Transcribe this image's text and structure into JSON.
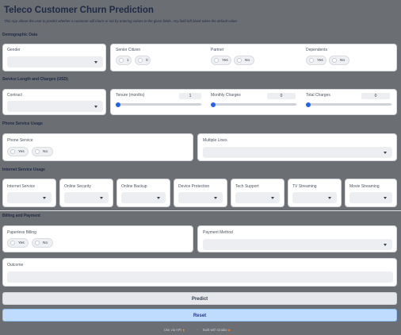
{
  "header": {
    "title": "Teleco Customer Churn Prediction",
    "description": "This App allows the user to predict whether a customer will churn or not by entering values in the given fields. Any field left blank takes the default value."
  },
  "demographic": {
    "section_label": "Demographic Data",
    "gender_label": "Gender",
    "senior_label": "Senior Citizen",
    "senior_opt1": "1",
    "senior_opt2": "0",
    "partner_label": "Partner",
    "partner_yes": "Yes",
    "partner_no": "No",
    "dependents_label": "Dependents",
    "dependents_yes": "Yes",
    "dependents_no": "No"
  },
  "service": {
    "section_label": "Service Length and Charges (USD)",
    "contract_label": "Contract",
    "tenure_label": "Tenure (months)",
    "tenure_value": "1",
    "tenure_level": 0,
    "monthly_label": "Monthly Charges",
    "monthly_value": "0",
    "monthly_level": 0,
    "total_label": "Total Charges",
    "total_value": "0",
    "total_level": 0
  },
  "phone": {
    "section_label": "Phone Service Usage",
    "phone_label": "Phone Service",
    "phone_yes": "Yes",
    "phone_no": "No",
    "lines_label": "Multiple Lines"
  },
  "internet": {
    "section_label": "Internet Service Usage",
    "fields": [
      "Internet Service",
      "Online Security",
      "Online Backup",
      "Device Protection",
      "Tech Support",
      "TV Streaming",
      "Movie Streaming"
    ]
  },
  "billing": {
    "section_label": "Billing and Payment",
    "paperless_label": "Paperless Billing",
    "paperless_yes": "Yes",
    "paperless_no": "No",
    "payment_label": "Payment Method"
  },
  "outcome": {
    "label": "Outcome",
    "value": ""
  },
  "actions": {
    "predict_label": "Predict",
    "reset_label": "Reset"
  },
  "footer": {
    "left": "Use via API",
    "right": "Built with Gradio"
  },
  "colors": {
    "accent": "#2563eb",
    "reset_bg": "#bfdbfe",
    "page_bg": "#6b6e73"
  }
}
